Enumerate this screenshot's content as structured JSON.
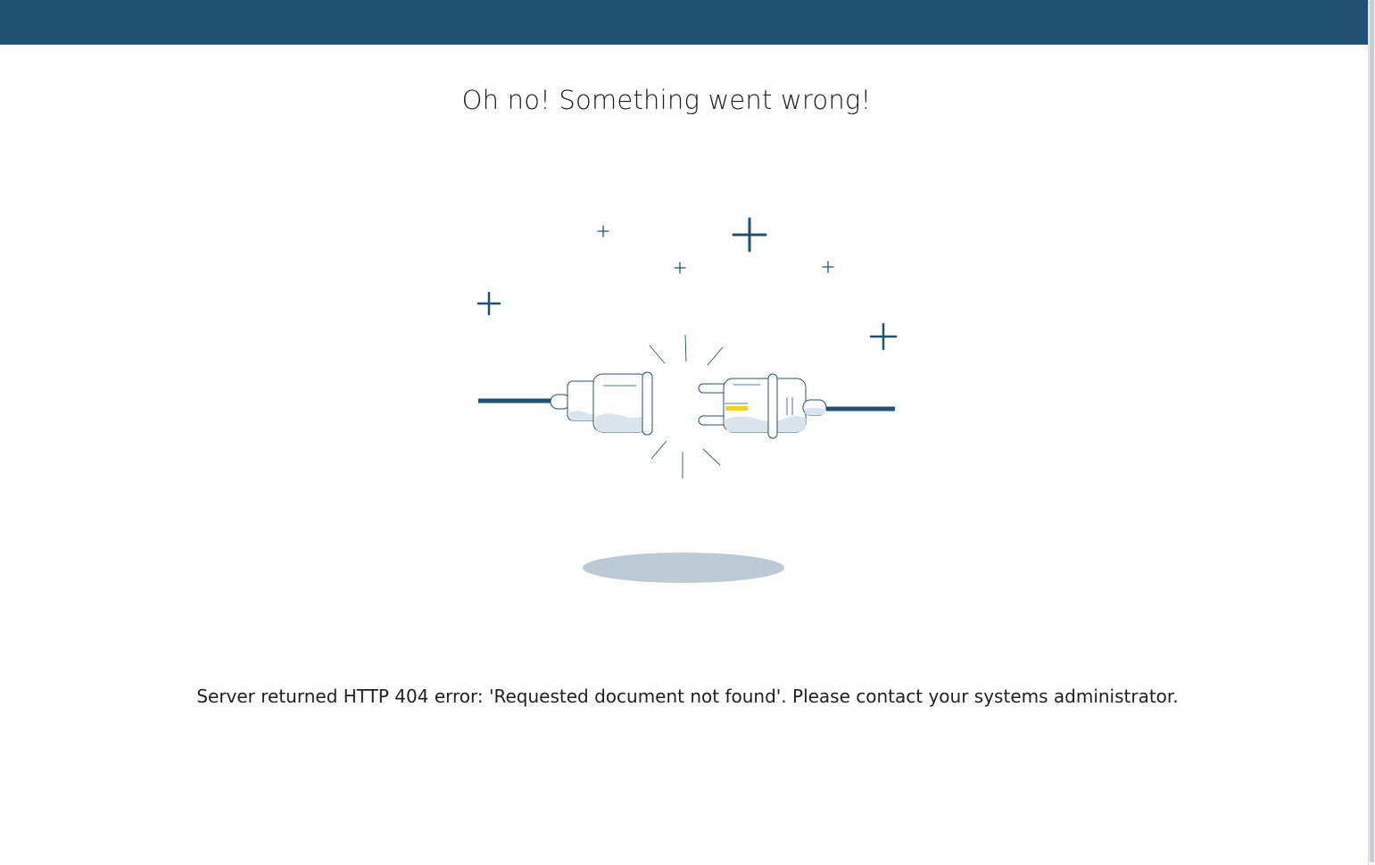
{
  "header": {
    "bar_color": "#215170"
  },
  "main": {
    "title": "Oh no! Something went wrong!",
    "illustration_icon": "unplugged-cable-icon",
    "message": "Server returned HTTP 404 error: 'Requested document not found'. Please contact your systems administrator."
  },
  "colors": {
    "accent": "#215170",
    "shadow": "#bccad6",
    "plug_fill": "#dbe4ec",
    "prong_highlight": "#f2d21b"
  }
}
